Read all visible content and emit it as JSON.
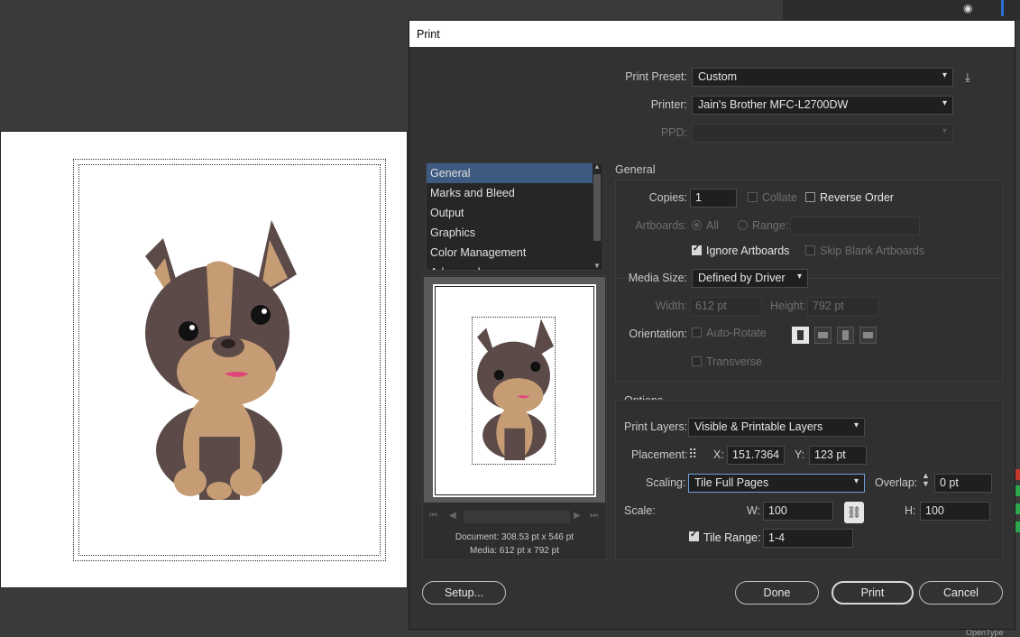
{
  "dialog_title": "Print",
  "print_preset": {
    "label": "Print Preset:",
    "value": "Custom"
  },
  "printer": {
    "label": "Printer:",
    "value": "Jain's Brother MFC-L2700DW"
  },
  "ppd": {
    "label": "PPD:",
    "value": ""
  },
  "categories": [
    "General",
    "Marks and Bleed",
    "Output",
    "Graphics",
    "Color Management",
    "Advanced"
  ],
  "active_category": "General",
  "general": {
    "header": "General",
    "copies_label": "Copies:",
    "copies": "1",
    "collate": "Collate",
    "reverse_order": "Reverse Order",
    "artboards_label": "Artboards:",
    "all": "All",
    "range": "Range:",
    "ignore_artboards": "Ignore Artboards",
    "skip_blank": "Skip Blank Artboards"
  },
  "media": {
    "size_label": "Media Size:",
    "size_value": "Defined by Driver",
    "width_label": "Width:",
    "width_value": "612 pt",
    "height_label": "Height:",
    "height_value": "792 pt",
    "orientation_label": "Orientation:",
    "auto_rotate": "Auto-Rotate",
    "transverse": "Transverse"
  },
  "options": {
    "header": "Options",
    "print_layers_label": "Print Layers:",
    "print_layers_value": "Visible & Printable Layers",
    "placement_label": "Placement:",
    "x_label": "X:",
    "x_value": "151.7364",
    "y_label": "Y:",
    "y_value": "123 pt",
    "scaling_label": "Scaling:",
    "scaling_value": "Tile Full Pages",
    "overlap_label": "Overlap:",
    "overlap_value": "0 pt",
    "scale_label": "Scale:",
    "w_label": "W:",
    "w_value": "100",
    "h_label": "H:",
    "h_value": "100",
    "tile_range_label": "Tile Range:",
    "tile_range_value": "1-4"
  },
  "preview_info": {
    "document": "Document: 308.53 pt x 546 pt",
    "media": "Media: 612 pt x 792 pt"
  },
  "buttons": {
    "setup": "Setup...",
    "done": "Done",
    "print": "Print",
    "cancel": "Cancel"
  },
  "bottom_label": "OpenType",
  "colors": {
    "dialog_bg": "#323232",
    "highlight": "#3d5a80",
    "canvas": "#ffffff"
  }
}
